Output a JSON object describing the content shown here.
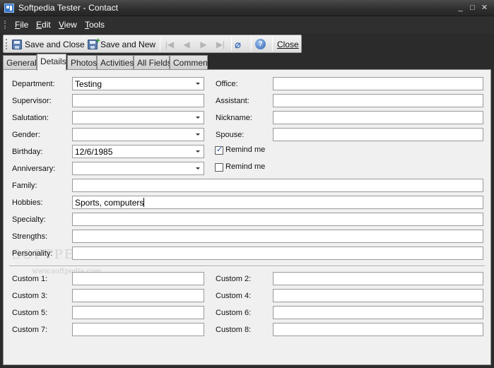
{
  "window": {
    "title": "Softpedia Tester - Contact"
  },
  "menu": {
    "items": [
      {
        "key": "F",
        "rest": "ile"
      },
      {
        "key": "E",
        "rest": "dit"
      },
      {
        "key": "V",
        "rest": "iew"
      },
      {
        "key": "T",
        "rest": "ools"
      }
    ]
  },
  "toolbar": {
    "save_close": "Save and Close",
    "save_new": "Save and New",
    "close": "Close"
  },
  "tabs": [
    "General",
    "Details",
    "Photos",
    "Activities",
    "All Fields",
    "Comment"
  ],
  "active_tab": "Details",
  "form": {
    "department": {
      "label": "Department:",
      "value": "Testing"
    },
    "supervisor": {
      "label": "Supervisor:",
      "value": ""
    },
    "salutation": {
      "label": "Salutation:",
      "value": ""
    },
    "gender": {
      "label": "Gender:",
      "value": ""
    },
    "birthday": {
      "label": "Birthday:",
      "value": "12/6/1985"
    },
    "anniversary": {
      "label": "Anniversary:",
      "value": ""
    },
    "office": {
      "label": "Office:",
      "value": ""
    },
    "assistant": {
      "label": "Assistant:",
      "value": ""
    },
    "nickname": {
      "label": "Nickname:",
      "value": ""
    },
    "spouse": {
      "label": "Spouse:",
      "value": ""
    },
    "remind1": {
      "label": "Remind me",
      "checked": true
    },
    "remind2": {
      "label": "Remind me",
      "checked": false
    },
    "family": {
      "label": "Family:",
      "value": ""
    },
    "hobbies": {
      "label": "Hobbies:",
      "value": "Sports, computers"
    },
    "specialty": {
      "label": "Specialty:",
      "value": ""
    },
    "strengths": {
      "label": "Strengths:",
      "value": ""
    },
    "personality": {
      "label": "Personality:",
      "value": ""
    }
  },
  "custom": {
    "c1": "Custom 1:",
    "c2": "Custom 2:",
    "c3": "Custom 3:",
    "c4": "Custom 4:",
    "c5": "Custom 5:",
    "c6": "Custom 6:",
    "c7": "Custom 7:",
    "c8": "Custom 8:"
  },
  "watermark": {
    "brand": "SOFTPEDIA",
    "url": "www.softpedia.com"
  }
}
